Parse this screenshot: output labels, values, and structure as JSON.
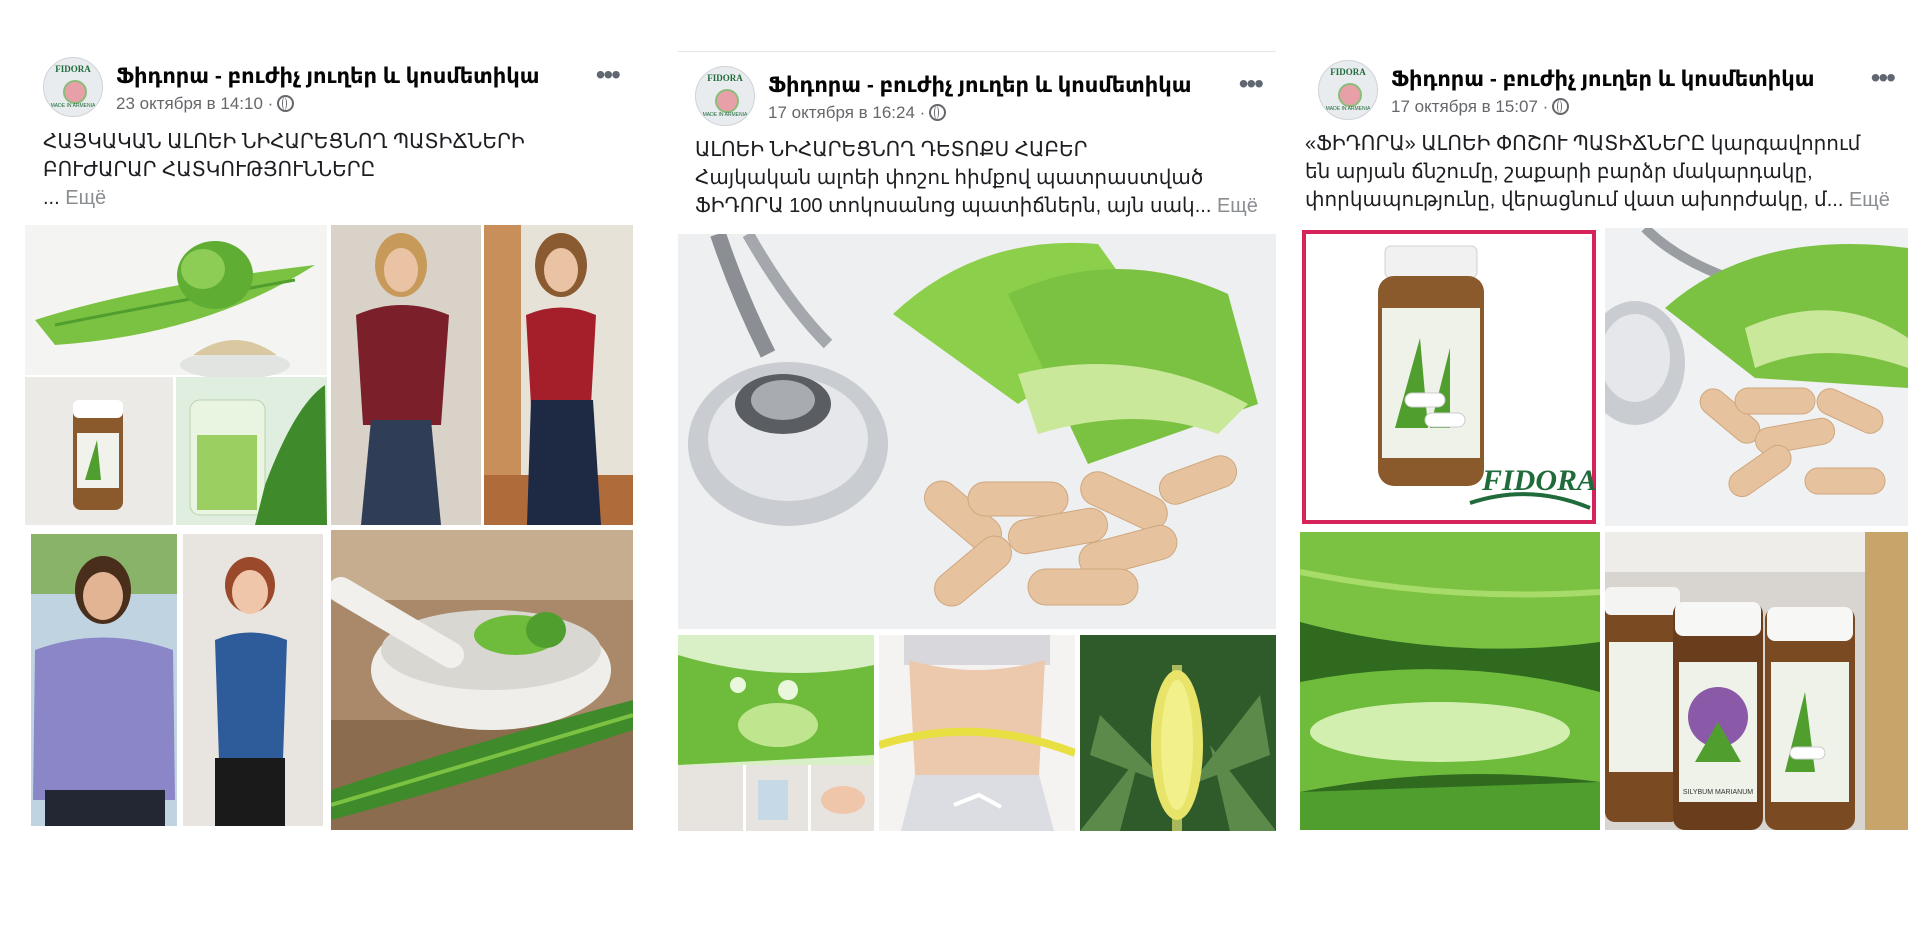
{
  "posts": [
    {
      "page_name": "Ֆիդորա - բուժիչ յուղեր և կոսմետիկա",
      "timestamp": "23 октября в 14:10 ·",
      "text_lines": [
        "ՀԱՅԿԱԿԱՆ ԱԼՈԵԻ ՆԻՀԱՐԵՑՆՈՂ ՊԱՏԻՃՆԵՐԻ",
        "ԲՈՒԺԱՐԱՐ ՀԱՏԿՈՒԹՅՈՒՆՆԵՐԸ"
      ],
      "ellipsis": "...",
      "more": "Ещё"
    },
    {
      "page_name": "Ֆիդորա - բուժիչ յուղեր և կոսմետիկա",
      "timestamp": "17 октября в 16:24 ·",
      "text_lines": [
        "ԱԼՈԵԻ ՆԻՀԱՐԵՑՆՈՂ ԴԵՏՈՔՍ ՀԱԲԵՐ",
        "Հայկական ալոեի փոշու հիմքով պատրաստված",
        "ՖԻԴՈՐԱ 100 տոկոսանոց պատիճներն, այն սակ..."
      ],
      "more": "Ещё"
    },
    {
      "page_name": "Ֆիդորա - բուժիչ յուղեր և կոսմետիկա",
      "timestamp": "17 октября в 15:07 ·",
      "text_lines": [
        "«ՖԻԴՈՐԱ» ԱԼՈԵԻ ՓՈՇՈՒ ՊԱՏԻՃՆԵՐԸ կարգավորում",
        "են արյան ճնշումը, շաքարի բարձր մակարդակը,",
        "փորկապությունը, վերացնում վատ ախորժակը, մ..."
      ],
      "more": "Ещё"
    }
  ],
  "logo": {
    "top": "FIDORA",
    "tagline": "MADE IN ARMENIA"
  },
  "product_brand": "FIDORA",
  "jar_label": "SILYBUM MARIANUM",
  "colors": {
    "aloe": "#7cc242",
    "aloe_dark": "#3f8a2a",
    "capsule": "#e6c39e",
    "frame": "#d6245a",
    "muted": "#65676b"
  }
}
